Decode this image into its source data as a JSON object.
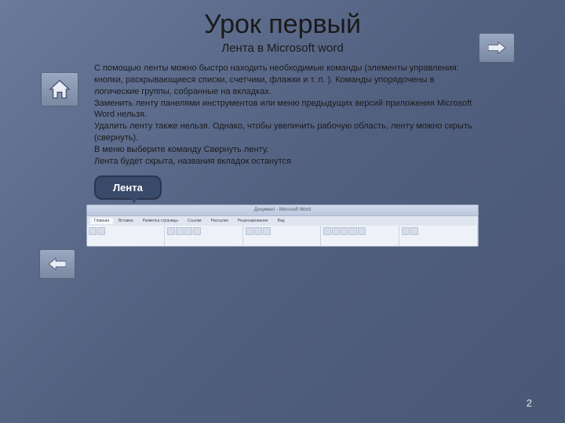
{
  "title": "Урок первый",
  "subtitle": "Лента в Microsoft word",
  "body": "С помощью ленты можно быстро находить необходимые команды (элементы управления: кнопки, раскрывающиеся списки, счетчики, флажки и т. п. ). Команды упорядочены в логические группы, собранные на вкладках.\nЗаменить ленту панелями инструментов или меню предыдущих версий приложения Microsoft Word нельзя.\nУдалить ленту также нельзя. Однако, чтобы увеличить рабочую область, ленту можно скрыть (свернуть).\nВ меню выберите команду Свернуть ленту.\nЛента будет скрыта, названия вкладок останутся",
  "callout": "Лента",
  "ribbon": {
    "window_title": "Документ - Microsoft Word",
    "tabs": [
      "Главная",
      "Вставка",
      "Разметка страницы",
      "Ссылки",
      "Рассылки",
      "Рецензирование",
      "Вид"
    ]
  },
  "page_number": "2",
  "nav": {
    "home_label": "home",
    "next_label": "next",
    "prev_label": "previous"
  }
}
